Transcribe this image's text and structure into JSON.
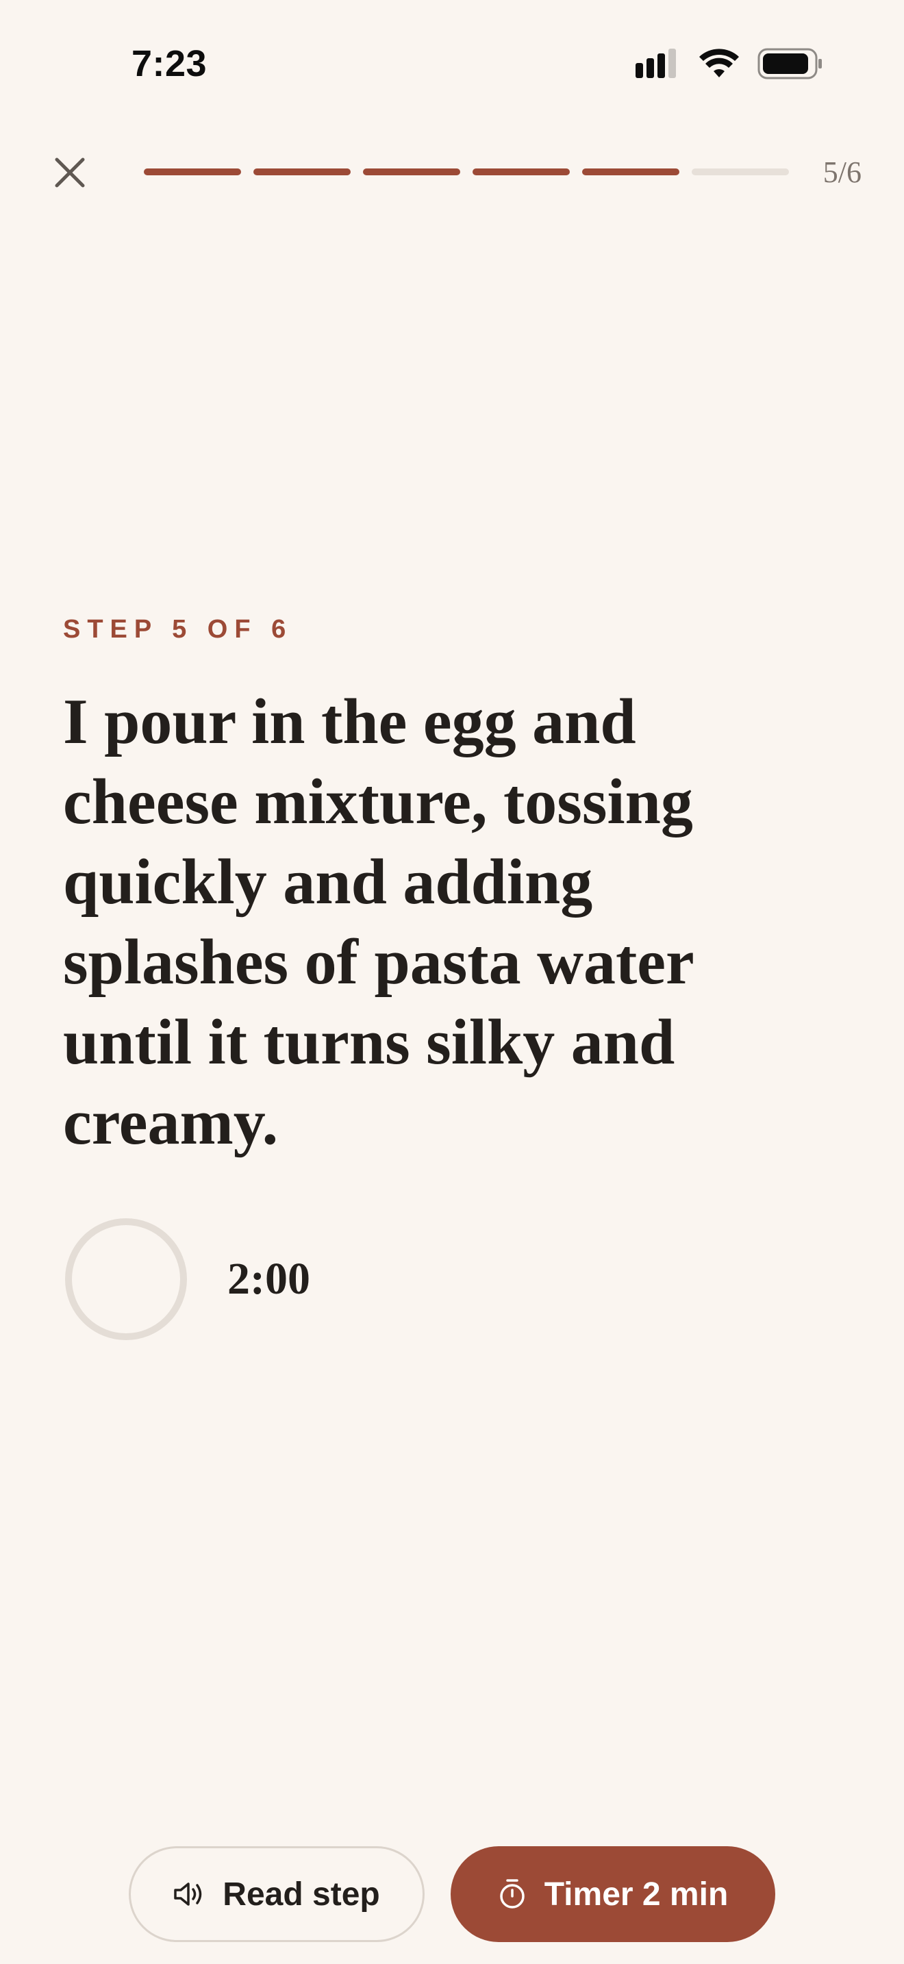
{
  "status_bar": {
    "time": "7:23"
  },
  "nav": {
    "close_icon": "close-icon",
    "progress": {
      "completed": 5,
      "total": 6
    },
    "step_count": "5/6"
  },
  "step": {
    "label": "STEP 5 OF 6",
    "text": "I pour in the egg and cheese mixture, tossing quickly and adding splashes of pasta water until it turns silky and creamy.",
    "timer": {
      "value": "2:00",
      "ring_progress": 0
    }
  },
  "actions": {
    "read_label": "Read step",
    "read_icon": "speaker-icon",
    "timer_label": "Timer 2 min",
    "timer_icon": "stopwatch-icon"
  },
  "colors": {
    "background": "#faf5f0",
    "accent": "#9c4a36",
    "track": "#e7e0d9",
    "text": "#231f1c"
  }
}
